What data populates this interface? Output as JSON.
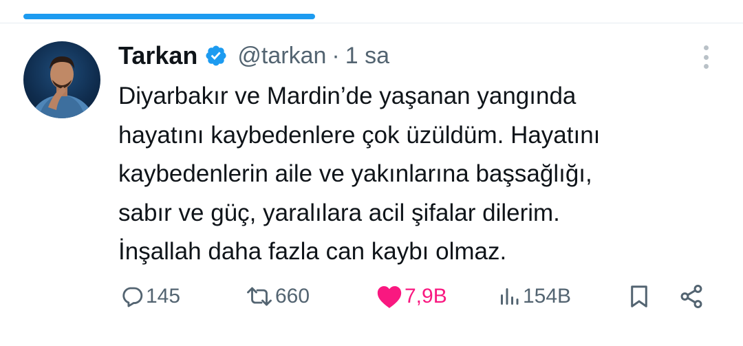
{
  "tweet": {
    "author": {
      "display_name": "Tarkan",
      "handle": "@tarkan",
      "verified_icon": "verified-badge-icon"
    },
    "separator": "·",
    "time": "1 sa",
    "text_lines": [
      "Diyarbakır ve Mardin’de yaşanan yangında",
      "hayatını kaybedenlere çok üzüldüm. Hayatını",
      "kaybedenlerin aile ve yakınlarına başsağlığı,",
      "sabır ve güç, yaralılara acil şifalar dilerim.",
      "İnşallah daha fazla can kaybı olmaz."
    ],
    "actions": {
      "replies": "145",
      "retweets": "660",
      "likes": "7,9B",
      "views": "154B"
    }
  },
  "colors": {
    "accent": "#1d9bf0",
    "like": "#f91880",
    "muted": "#536471"
  }
}
